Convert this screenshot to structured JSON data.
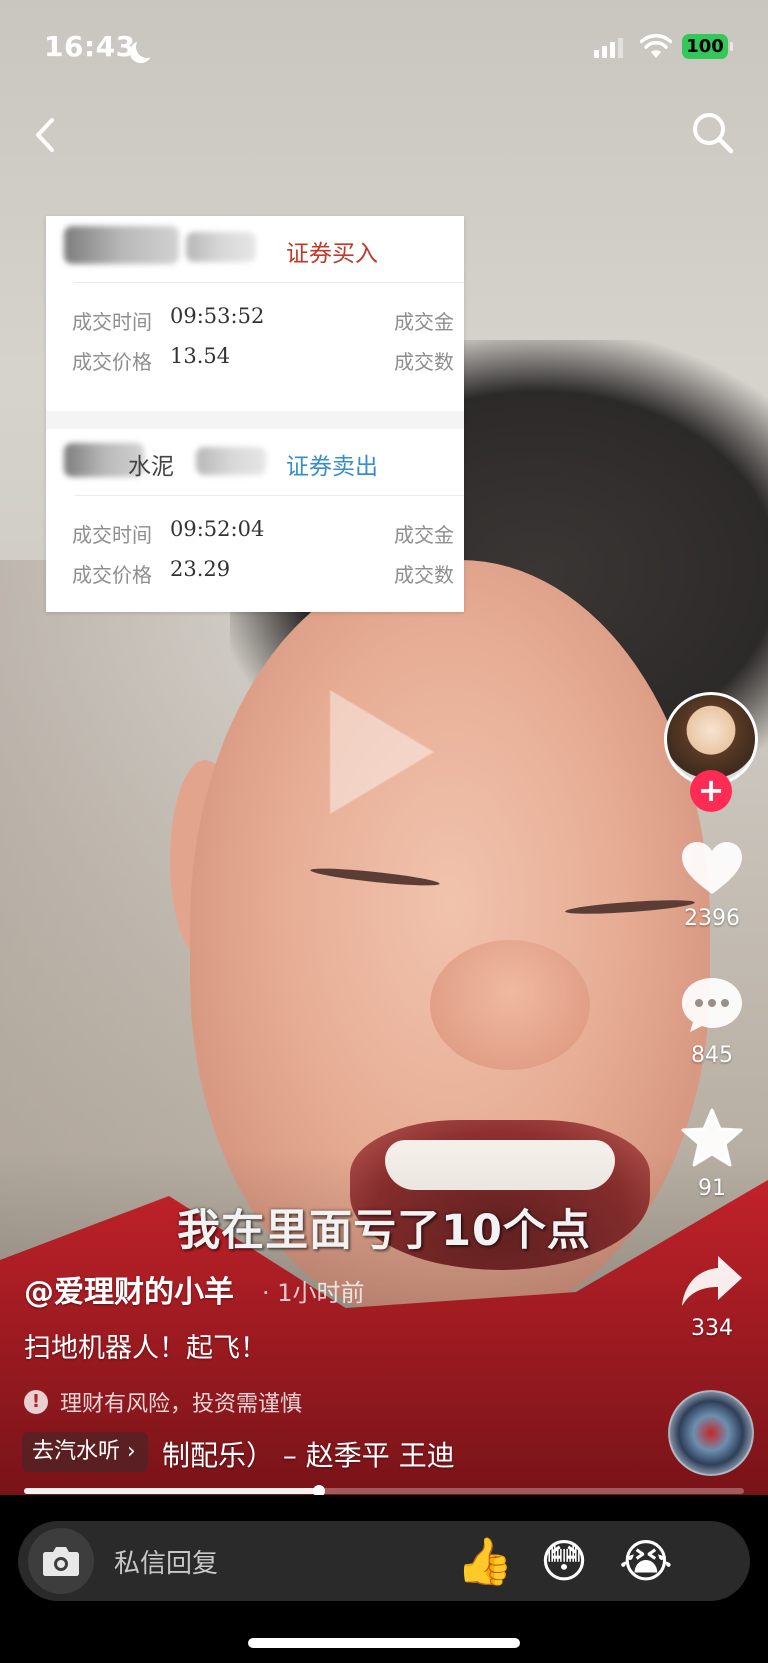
{
  "status_bar": {
    "time": "16:43",
    "battery": "100",
    "icons": [
      "moon-icon",
      "signal-icon",
      "wifi-icon",
      "battery-icon"
    ]
  },
  "nav": {
    "back_icon": "chevron-left-icon",
    "search_icon": "search-icon"
  },
  "trade_card": {
    "entries": [
      {
        "name": "泥",
        "action": "证券买入",
        "action_color": "#c0392b",
        "time_label": "成交时间",
        "time_value": "09:53:52",
        "price_label": "成交价格",
        "price_value": "13.54",
        "amount_label": "成交金",
        "qty_label": "成交数"
      },
      {
        "name": "水泥",
        "action": "证券卖出",
        "action_color": "#3a8dc9",
        "time_label": "成交时间",
        "time_value": "09:52:04",
        "price_label": "成交价格",
        "price_value": "23.29",
        "amount_label": "成交金",
        "qty_label": "成交数"
      }
    ]
  },
  "actions": {
    "follow": "+",
    "likes": "2396",
    "comments": "845",
    "favorites": "91",
    "shares": "334"
  },
  "caption": "我在里面亏了10个点",
  "post": {
    "author": "@爱理财的小羊",
    "posted": "· 1小时前",
    "description": "扫地机器人！起飞！",
    "risk_notice": "理财有风险，投资需谨慎",
    "music_button": "去汽水听 ›",
    "music_text": "制配乐） – 赵季平    王迪"
  },
  "progress": {
    "fraction": 0.41
  },
  "reply_bar": {
    "placeholder": "私信回复",
    "emojis": [
      "👍",
      "😳",
      "😭"
    ]
  },
  "colors": {
    "accent": "#fe2c55",
    "battery": "#34c759"
  }
}
